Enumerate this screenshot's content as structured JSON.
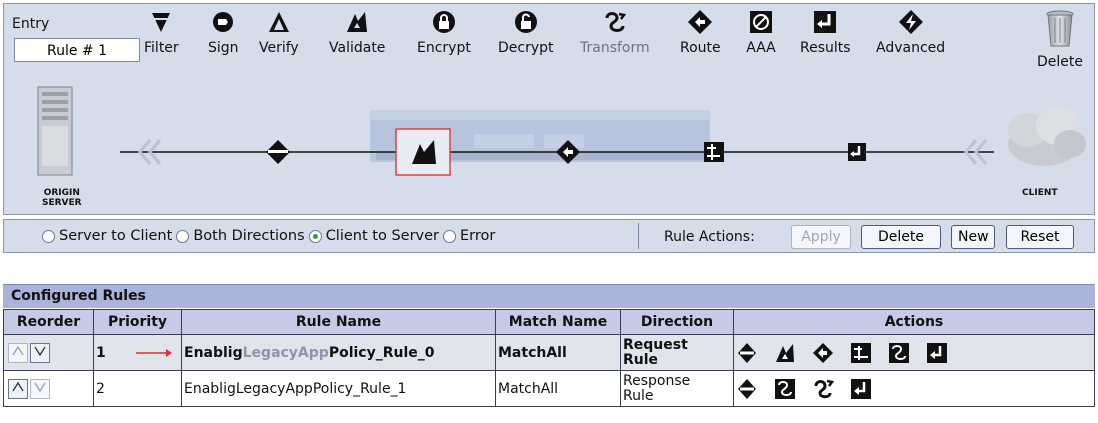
{
  "editor": {
    "entry_label": "Entry",
    "entry_value": "Rule # 1",
    "tools": [
      {
        "label": "Filter",
        "icon": "filter-icon",
        "dim": false
      },
      {
        "label": "Sign",
        "icon": "sign-icon",
        "dim": false
      },
      {
        "label": "Verify",
        "icon": "verify-icon",
        "dim": false
      },
      {
        "label": "Validate",
        "icon": "validate-icon",
        "dim": false
      },
      {
        "label": "Encrypt",
        "icon": "encrypt-lock-icon",
        "dim": false
      },
      {
        "label": "Decrypt",
        "icon": "decrypt-lock-icon",
        "dim": false
      },
      {
        "label": "Transform",
        "icon": "transform-icon",
        "dim": true
      },
      {
        "label": "Route",
        "icon": "route-icon",
        "dim": false
      },
      {
        "label": "AAA",
        "icon": "aaa-icon",
        "dim": false
      },
      {
        "label": "Results",
        "icon": "results-icon",
        "dim": false
      },
      {
        "label": "Advanced",
        "icon": "advanced-icon",
        "dim": false
      }
    ],
    "delete_label": "Delete",
    "server_label_1": "ORIGIN",
    "server_label_2": "SERVER",
    "client_label": "CLIENT"
  },
  "direction_bar": {
    "options": [
      {
        "label": "Server to Client",
        "selected": false
      },
      {
        "label": "Both Directions",
        "selected": false
      },
      {
        "label": "Client to Server",
        "selected": true
      },
      {
        "label": "Error",
        "selected": false
      }
    ],
    "rule_actions_label": "Rule Actions:",
    "apply_label": "Apply",
    "delete_label": "Delete",
    "new_label": "New",
    "reset_label": "Reset"
  },
  "rules": {
    "title": "Configured Rules",
    "headers": {
      "reorder": "Reorder",
      "priority": "Priority",
      "rule_name": "Rule Name",
      "match_name": "Match Name",
      "direction": "Direction",
      "actions": "Actions"
    },
    "rows": [
      {
        "priority": "1",
        "name_a": "Enablig",
        "name_b": "LegacyApp",
        "name_c": "Policy_Rule_0",
        "match": "MatchAll",
        "direction_1": "Request",
        "direction_2": "Rule",
        "actions": [
          "filter-icon",
          "validate-icon",
          "route-icon",
          "transform-xslt-icon",
          "transform-icon",
          "results-icon"
        ]
      },
      {
        "priority": "2",
        "name": "EnabligLegacyAppPolicy_Rule_1",
        "match": "MatchAll",
        "direction_1": "Response",
        "direction_2": "Rule",
        "actions": [
          "filter-icon",
          "transform-icon",
          "transform-xform-icon",
          "results-icon"
        ]
      }
    ]
  },
  "colors": {
    "panel_bg": "#d5dcea",
    "header_bg": "#aab3d9",
    "selected_action_border": "#e04040",
    "arrow": "#e03030"
  }
}
